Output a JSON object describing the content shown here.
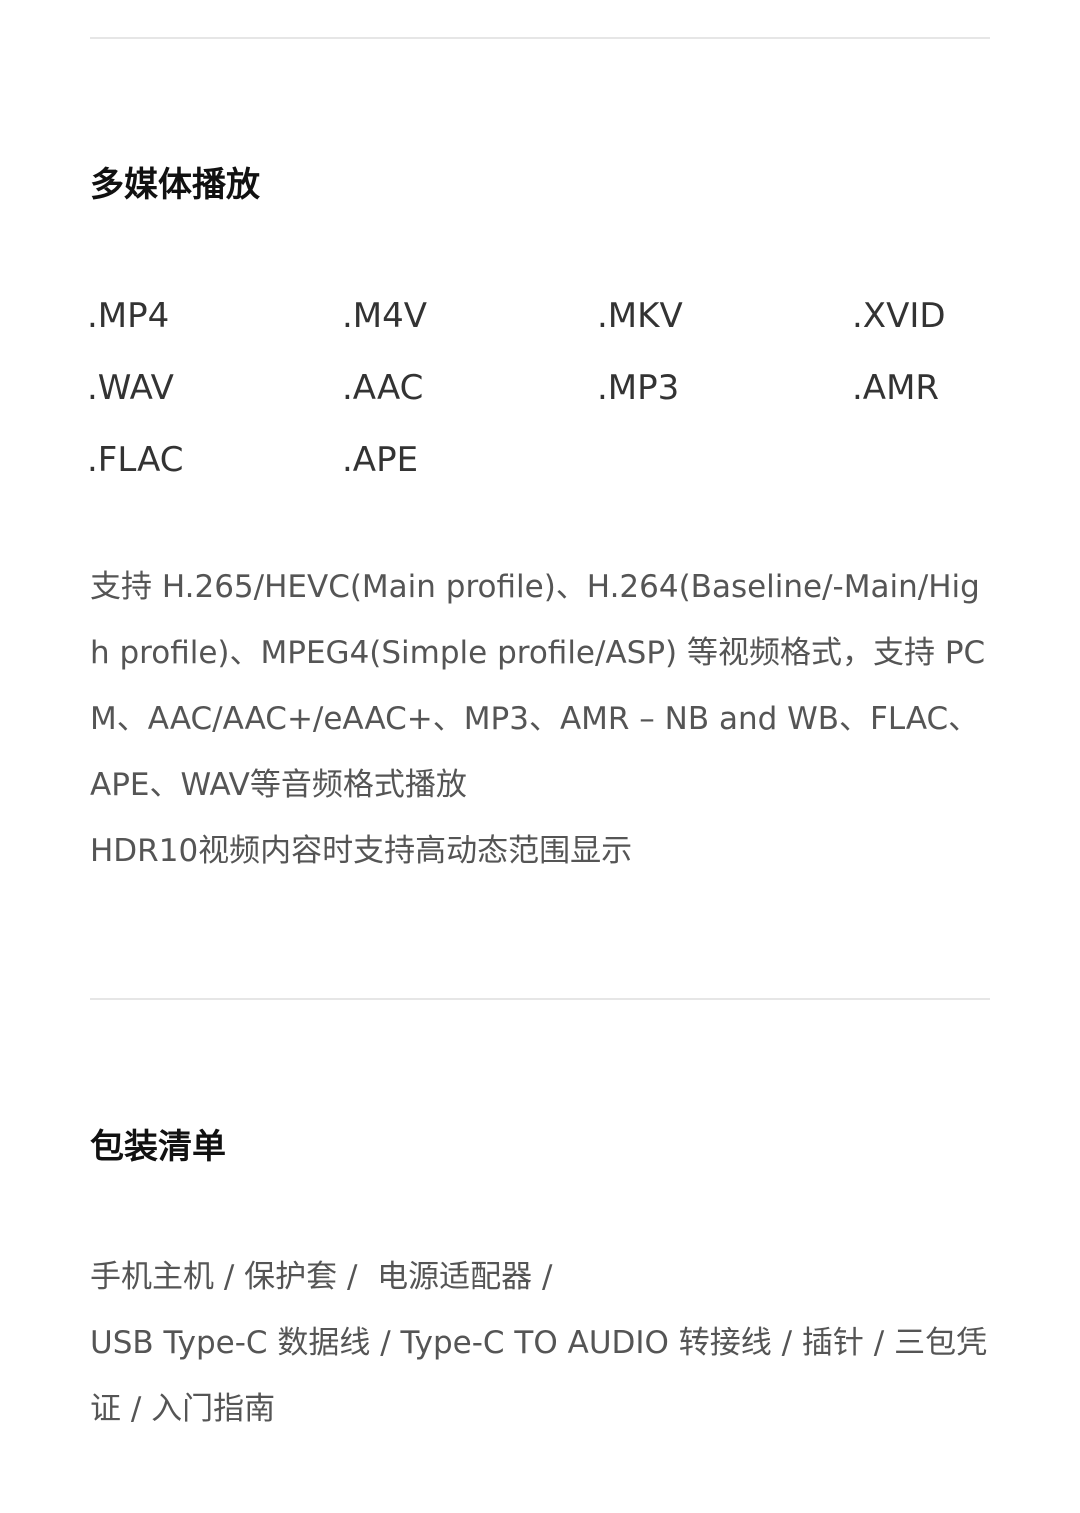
{
  "multimedia": {
    "title": "多媒体播放",
    "formats": [
      ".MP4",
      ".M4V",
      ".MKV",
      ".XVID",
      ".WAV",
      ".AAC",
      ".MP3",
      ".AMR",
      ".FLAC",
      ".APE"
    ],
    "description": "支持 H.265/HEVC(Main profile)、H.264(Baseline/-Main/High profile)、MPEG4(Simple profile/ASP) 等视频格式，支持 PCM、AAC/AAC+/eAAC+、MP3、AMR – NB and WB、FLAC、APE、WAV等音频格式播放",
    "hdr_note": "HDR10视频内容时支持高动态范围显示"
  },
  "package": {
    "title": "包装清单",
    "line1": "手机主机 / 保护套 /  电源适配器 /",
    "line2": "USB Type-C 数据线 / Type-C TO AUDIO 转接线 / 插针 / 三包凭证 / 入门指南"
  }
}
